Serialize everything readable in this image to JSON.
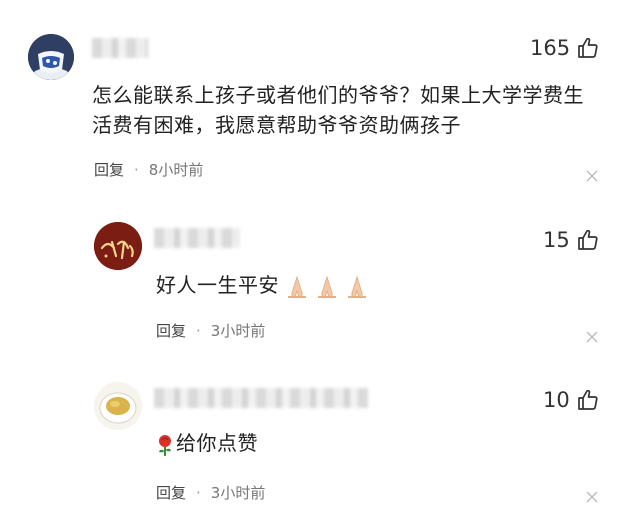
{
  "comments": [
    {
      "text": "怎么能联系上孩子或者他们的爷爷？如果上大学学费生活费有困难，我愿意帮助爷爷资助俩孩子",
      "likes": "165",
      "reply_label": "回复",
      "time": "8小时前",
      "avatar_icon": "porcelain-vase-avatar",
      "like_icon": "thumbs-up-icon",
      "close_icon": "close-icon"
    },
    {
      "text": "好人一生平安",
      "emoji": "pray-hands-emoji",
      "likes": "15",
      "reply_label": "回复",
      "time": "3小时前",
      "avatar_icon": "calligraphy-avatar",
      "like_icon": "thumbs-up-icon",
      "close_icon": "close-icon"
    },
    {
      "text": "给你点赞",
      "emoji": "rose-emoji",
      "likes": "10",
      "reply_label": "回复",
      "time": "3小时前",
      "avatar_icon": "tea-cup-avatar",
      "like_icon": "thumbs-up-icon",
      "close_icon": "close-icon"
    }
  ]
}
